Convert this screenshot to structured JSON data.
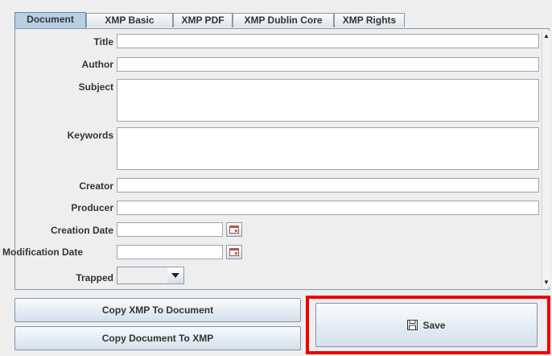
{
  "tabs": [
    {
      "label": "Document",
      "active": true
    },
    {
      "label": "XMP Basic"
    },
    {
      "label": "XMP PDF"
    },
    {
      "label": "XMP Dublin Core"
    },
    {
      "label": "XMP Rights"
    }
  ],
  "fields": {
    "title": {
      "label": "Title",
      "value": ""
    },
    "author": {
      "label": "Author",
      "value": ""
    },
    "subject": {
      "label": "Subject",
      "value": ""
    },
    "keywords": {
      "label": "Keywords",
      "value": ""
    },
    "creator": {
      "label": "Creator",
      "value": ""
    },
    "producer": {
      "label": "Producer",
      "value": ""
    },
    "creation_date": {
      "label": "Creation Date",
      "value": ""
    },
    "modification_date": {
      "label": "Modification Date",
      "value": ""
    },
    "trapped": {
      "label": "Trapped",
      "value": ""
    }
  },
  "icons": {
    "calendar": "calendar-icon",
    "save": "floppy-disk-icon",
    "dropdown": "chevron-down-icon"
  },
  "buttons": {
    "copy_xmp_to_document": "Copy XMP To Document",
    "copy_document_to_xmp": "Copy Document To XMP",
    "save": "Save"
  },
  "colors": {
    "highlight": "#ee0000",
    "active_tab": "#b8cfe5"
  }
}
